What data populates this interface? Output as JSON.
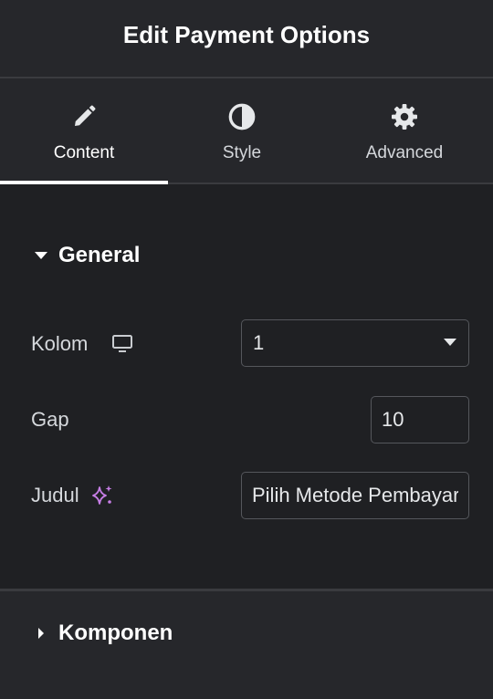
{
  "header": {
    "title": "Edit Payment Options"
  },
  "tabs": [
    {
      "label": "Content",
      "icon": "pencil-icon",
      "active": true
    },
    {
      "label": "Style",
      "icon": "contrast-icon",
      "active": false
    },
    {
      "label": "Advanced",
      "icon": "gear-icon",
      "active": false
    }
  ],
  "general": {
    "heading": "General",
    "expanded": true,
    "kolom": {
      "label": "Kolom",
      "icon": "desktop-icon",
      "value": "1"
    },
    "gap": {
      "label": "Gap",
      "value": "10"
    },
    "judul": {
      "label": "Judul",
      "icon": "ai-sparkle-icon",
      "value": "Pilih Metode Pembayaran"
    }
  },
  "komponen": {
    "heading": "Komponen",
    "expanded": false
  },
  "colors": {
    "panel_bg": "#26272b",
    "section_bg": "#1f2023",
    "text": "#e6e8ea",
    "accent_ai": "#c77ee6",
    "border": "#55575c"
  }
}
